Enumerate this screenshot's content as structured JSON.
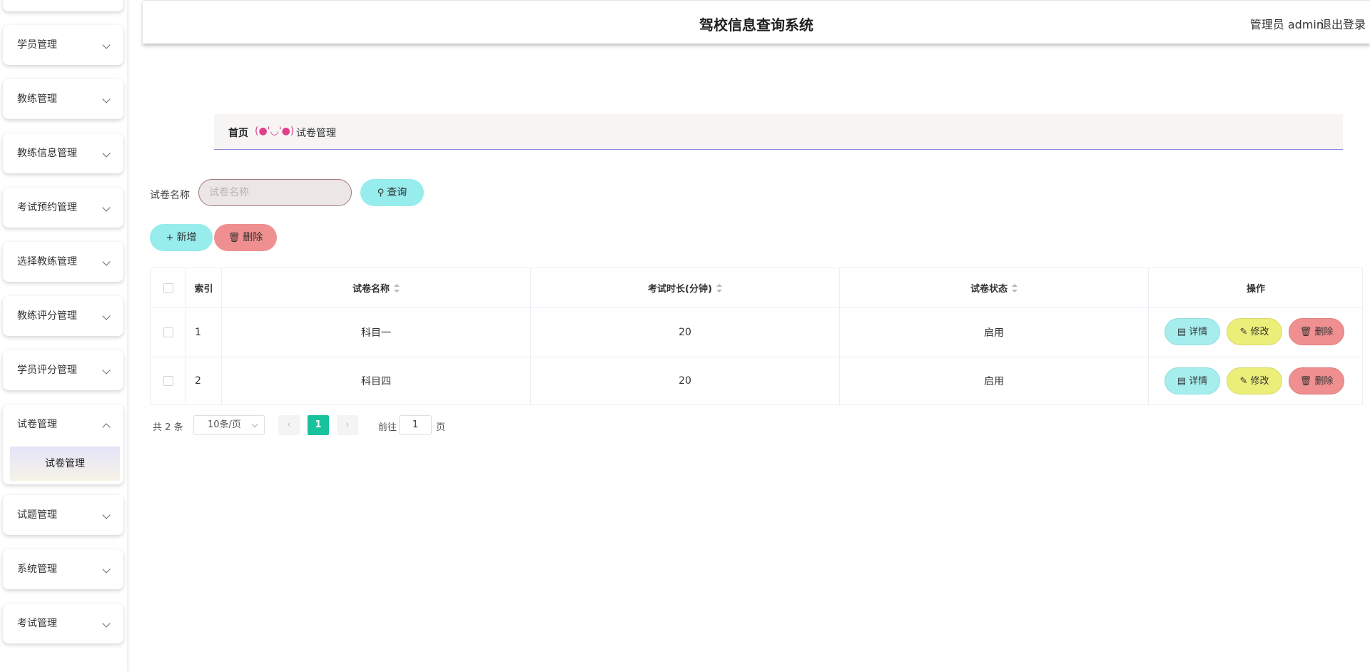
{
  "header": {
    "title": "驾校信息查询系统",
    "user": "管理员 admin",
    "logout": "退出登录"
  },
  "sidebar": {
    "items": [
      {
        "label": "学员管理",
        "expanded": false
      },
      {
        "label": "教练管理",
        "expanded": false
      },
      {
        "label": "教练信息管理",
        "expanded": false
      },
      {
        "label": "考试预约管理",
        "expanded": false
      },
      {
        "label": "选择教练管理",
        "expanded": false
      },
      {
        "label": "教练评分管理",
        "expanded": false
      },
      {
        "label": "学员评分管理",
        "expanded": false
      },
      {
        "label": "试卷管理",
        "expanded": true,
        "children": [
          "试卷管理"
        ]
      },
      {
        "label": "试题管理",
        "expanded": false
      },
      {
        "label": "系统管理",
        "expanded": false
      },
      {
        "label": "考试管理",
        "expanded": false
      }
    ]
  },
  "breadcrumb": {
    "home": "首页",
    "separator": "(●'◡'●)",
    "current": "试卷管理"
  },
  "search": {
    "label": "试卷名称",
    "placeholder": "试卷名称",
    "value": "",
    "query_button": "查询"
  },
  "toolbar": {
    "add_button": "新增",
    "delete_button": "删除"
  },
  "table": {
    "columns": [
      "索引",
      "试卷名称",
      "考试时长(分钟)",
      "试卷状态",
      "操作"
    ],
    "rows": [
      {
        "index": "1",
        "name": "科目一",
        "duration": "20",
        "status": "启用"
      },
      {
        "index": "2",
        "name": "科目四",
        "duration": "20",
        "status": "启用"
      }
    ],
    "actions": {
      "detail": "详情",
      "edit": "修改",
      "delete": "删除"
    }
  },
  "pagination": {
    "total": "共 2 条",
    "page_size": "10条/页",
    "current_page": "1",
    "goto_label": "前往",
    "goto_value": "1",
    "page_unit": "页"
  },
  "colors": {
    "primary_cyan": "#97ecec",
    "danger_red": "#ef8f8f",
    "edit_yellow": "#ecee7a",
    "page_active": "#18c29c",
    "breadcrumb_accent": "#e0408a"
  }
}
